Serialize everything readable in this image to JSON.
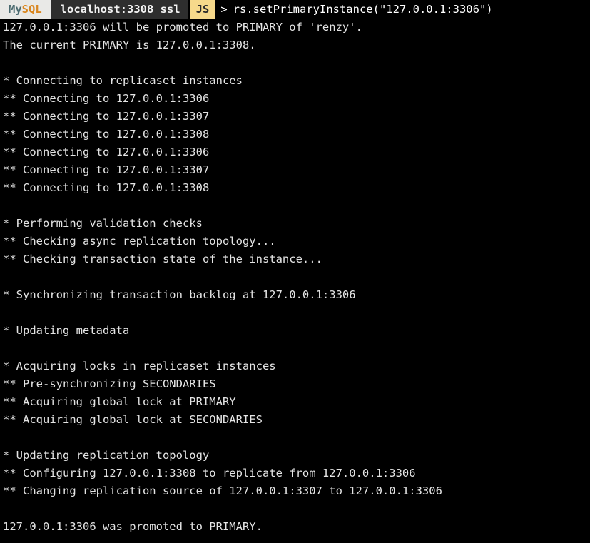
{
  "terminal": {
    "background_color": "#000000",
    "text_color": "#e4e4e4",
    "prompt": {
      "mysql_badge": {
        "prefix": "My",
        "suffix": "SQL",
        "background_color": "#e9e9e7",
        "prefix_color": "#4a6a70",
        "suffix_color": "#d9861f"
      },
      "host_segment": {
        "label": "localhost:3308 ssl",
        "background_color": "#2e2e2e",
        "text_color": "#f2f2f2"
      },
      "mode_badge": {
        "label": "JS",
        "background_color": "#f6d98b",
        "text_color": "#2a2a2a"
      },
      "caret": ">",
      "command": "rs.setPrimaryInstance(\"127.0.0.1:3306\")"
    },
    "output_lines": [
      "127.0.0.1:3306 will be promoted to PRIMARY of 'renzy'.",
      "The current PRIMARY is 127.0.0.1:3308.",
      "",
      "* Connecting to replicaset instances",
      "** Connecting to 127.0.0.1:3306",
      "** Connecting to 127.0.0.1:3307",
      "** Connecting to 127.0.0.1:3308",
      "** Connecting to 127.0.0.1:3306",
      "** Connecting to 127.0.0.1:3307",
      "** Connecting to 127.0.0.1:3308",
      "",
      "* Performing validation checks",
      "** Checking async replication topology...",
      "** Checking transaction state of the instance...",
      "",
      "* Synchronizing transaction backlog at 127.0.0.1:3306",
      "",
      "* Updating metadata",
      "",
      "* Acquiring locks in replicaset instances",
      "** Pre-synchronizing SECONDARIES",
      "** Acquiring global lock at PRIMARY",
      "** Acquiring global lock at SECONDARIES",
      "",
      "* Updating replication topology",
      "** Configuring 127.0.0.1:3308 to replicate from 127.0.0.1:3306",
      "** Changing replication source of 127.0.0.1:3307 to 127.0.0.1:3306",
      "",
      "127.0.0.1:3306 was promoted to PRIMARY."
    ]
  }
}
